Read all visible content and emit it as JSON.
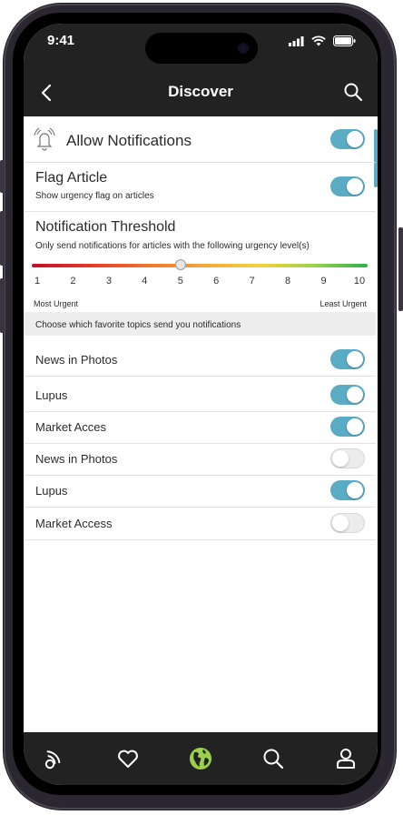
{
  "status_bar": {
    "time": "9:41"
  },
  "nav": {
    "title": "Discover"
  },
  "settings": {
    "allow_notifications": {
      "label": "Allow Notifications",
      "enabled": true
    },
    "flag_article": {
      "label": "Flag Article",
      "description": "Show urgency flag on articles",
      "enabled": true
    },
    "threshold": {
      "title": "Notification Threshold",
      "description": "Only send notifications for articles with the following urgency level(s)",
      "ticks": [
        "1",
        "2",
        "3",
        "4",
        "5",
        "6",
        "7",
        "8",
        "9",
        "10"
      ],
      "selected": 5,
      "min_label": "Most Urgent",
      "max_label": "Least Urgent"
    },
    "topics_header": "Choose which favorite topics send you notifications",
    "topics": [
      {
        "label": "News in Photos",
        "enabled": true
      },
      {
        "label": "Lupus",
        "enabled": true
      },
      {
        "label": "Market Acces",
        "enabled": true
      },
      {
        "label": "News in Photos",
        "enabled": false
      },
      {
        "label": "Lupus",
        "enabled": true
      },
      {
        "label": "Market Access",
        "enabled": false
      }
    ]
  },
  "tab_bar": {
    "items": [
      "feed-icon",
      "heart-icon",
      "globe-icon",
      "search-icon",
      "profile-icon"
    ],
    "active": "globe-icon"
  },
  "colors": {
    "accent": "#5aabc4",
    "bar_bg": "#222222",
    "active_tab": "#9bd14a"
  }
}
